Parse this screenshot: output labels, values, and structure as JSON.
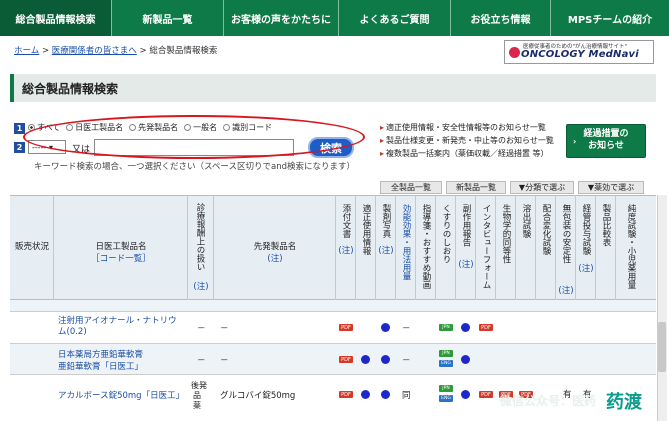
{
  "nav": {
    "tabs": [
      {
        "label": "総合製品情報検索",
        "active": true
      },
      {
        "label": "新製品一覧"
      },
      {
        "label": "お客様の声をかたちに"
      },
      {
        "label": "よくあるご質問"
      },
      {
        "label": "お役立ち情報"
      },
      {
        "label": "MPSチームの紹介"
      }
    ]
  },
  "breadcrumb": {
    "home": "ホーム",
    "sep": ">",
    "medical": "医療関係者の皆さまへ",
    "current": "総合製品情報検索"
  },
  "logo": {
    "tagline": "医療従事者のための\"がん治療情報サイト\"",
    "name": "ONCOLOGY MedNavi"
  },
  "page_title": "総合製品情報検索",
  "search": {
    "step1": "1",
    "step2": "2",
    "radios": [
      "すべて",
      "日医工製品名",
      "先発製品名",
      "一般名",
      "識別コード"
    ],
    "select_value": "-----",
    "or_label": "又は",
    "input_placeholder": "",
    "button_label": "検索",
    "hint": "キーワード検索の場合、一つ選択ください（スペース区切りでand検索になります）"
  },
  "notices": [
    "適正使用情報・安全性情報等のお知らせ一覧",
    "製品仕様変更・新発売・中止等のお知らせ一覧",
    "複数製品一括案内（薬価収載／経過措置 等）"
  ],
  "green_button": {
    "line1": "経過措置の",
    "line2": "お知らせ"
  },
  "sub_tabs": [
    "全製品一覧",
    "新製品一覧",
    "▼分類で選ぶ",
    "▼薬効で選ぶ"
  ],
  "table": {
    "headers": {
      "status": "販売状況",
      "product": "日医工製品名",
      "code_list": "［コード一覧］",
      "insurance": "診療報酬上の扱い",
      "note": "(注)",
      "original": "先発製品名",
      "attach": "添付文書",
      "proper_use": "適正使用情報",
      "photo": "製剤写真",
      "efficacy": "効能効果・用法用量",
      "guidance": "指導箋・おすすめ動画",
      "kusuri": "くすりのしおり",
      "side": "副作用報告",
      "interview": "インタビューフォーム",
      "bioeq": "生物学的同等性",
      "dissolution": "溶出試験",
      "stability": "配合変化試験",
      "open_stab": "無包装の安定性",
      "tube": "経管投与試験",
      "compare": "製品比較表",
      "purity": "純度試験・小児薬用量"
    },
    "rows": [
      {
        "product": "注射用アイオナール・ナトリウム(0.2)",
        "insurance": "－",
        "original": "－",
        "pdf": "PDF",
        "bullet": "",
        "dash": "－"
      },
      {
        "product_l1": "日本薬局方亜鉛華軟膏",
        "product_l2": "亜鉛華軟膏「日医工」",
        "insurance": "－",
        "original": "－",
        "dash": "－"
      },
      {
        "product": "アカルボース錠50mg「日医工」",
        "insurance_l1": "後発",
        "insurance_l2": "品",
        "insurance_l3": "薬",
        "original": "グルコバイ錠50mg",
        "dash": "同",
        "extra1": "有",
        "extra2": "有"
      }
    ]
  },
  "badges": {
    "pdf": "PDF",
    "jpn": "JPN",
    "eng": "ENG"
  },
  "watermark": "微信公众号：医药",
  "wm_brand": "药渡"
}
